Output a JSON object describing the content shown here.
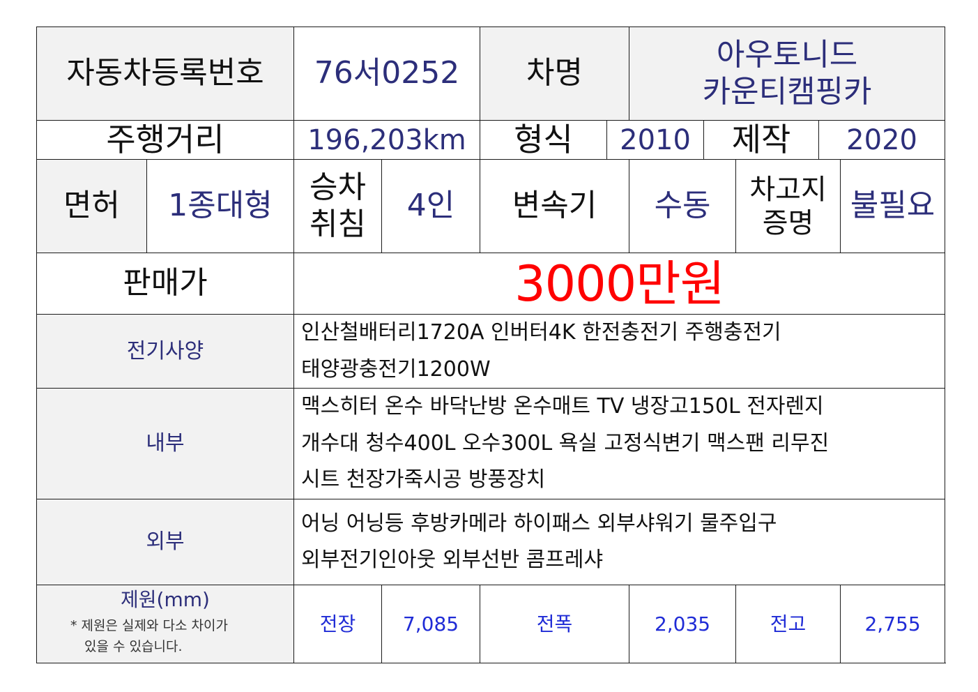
{
  "row1": {
    "reg_label": "자동차등록번호",
    "reg_value": "76서0252",
    "name_label": "차명",
    "name_value_1": "아우토니드",
    "name_value_2": "카운티캠핑카"
  },
  "row2": {
    "mileage_label": "주행거리",
    "mileage_value": "196,203km",
    "model_label": "형식",
    "model_value": "2010",
    "make_label": "제작",
    "make_value": "2020"
  },
  "row3": {
    "license_label": "면허",
    "license_value": "1종대형",
    "capacity_label_1": "승차",
    "capacity_label_2": "취침",
    "capacity_value": "4인",
    "transmission_label": "변속기",
    "transmission_value": "수동",
    "garage_label_1": "차고지",
    "garage_label_2": "증명",
    "garage_value": "불필요"
  },
  "price": {
    "label": "판매가",
    "value": "3000만원"
  },
  "electrical": {
    "label": "전기사양",
    "line1": "인산철배터리1720A 인버터4K 한전충전기 주행충전기",
    "line2": "태양광충전기1200W"
  },
  "interior": {
    "label": "내부",
    "line1": "맥스히터 온수 바닥난방 온수매트 TV 냉장고150L 전자렌지",
    "line2": "개수대 청수400L 오수300L 욕실 고정식변기 맥스팬 리무진",
    "line3": "시트 천장가죽시공 방풍장치"
  },
  "exterior": {
    "label": "외부",
    "line1": "어닝 어닝등 후방카메라 하이패스 외부샤워기 물주입구",
    "line2": "외부전기인아웃 외부선반 콤프레샤"
  },
  "dimensions": {
    "label": "제원(mm)",
    "note_1": "* 제원은 실제와 다소 차이가",
    "note_2": "있을 수 있습니다.",
    "length_label": "전장",
    "length_value": "7,085",
    "width_label": "전폭",
    "width_value": "2,035",
    "height_label": "전고",
    "height_value": "2,755"
  },
  "colors": {
    "label_bg": "#f2f2f2",
    "value_text": "#2c2e7a",
    "price_text": "#ff0000",
    "dimension_text": "#1f2bd6"
  }
}
